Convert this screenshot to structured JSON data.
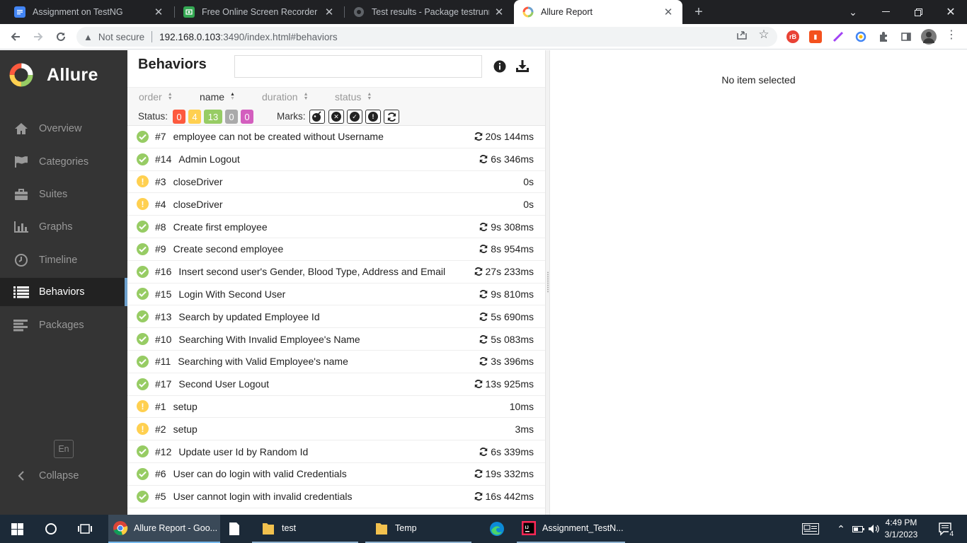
{
  "browser": {
    "tabs": [
      {
        "title": "Assignment on TestNG",
        "icon": "google-docs-icon",
        "active": false
      },
      {
        "title": "Free Online Screen Recorder | Onl",
        "icon": "screen-recorder-icon",
        "active": false
      },
      {
        "title": "Test results - Package testrunner",
        "icon": "globe-icon",
        "active": false
      },
      {
        "title": "Allure Report",
        "icon": "allure-icon",
        "active": true
      }
    ],
    "security_label": "Not secure",
    "url_host": "192.168.0.103",
    "url_path": ":3490/index.html#behaviors"
  },
  "sidebar": {
    "brand": "Allure",
    "items": [
      {
        "label": "Overview",
        "icon": "home-icon"
      },
      {
        "label": "Categories",
        "icon": "flag-icon"
      },
      {
        "label": "Suites",
        "icon": "briefcase-icon"
      },
      {
        "label": "Graphs",
        "icon": "bar-chart-icon"
      },
      {
        "label": "Timeline",
        "icon": "clock-icon"
      },
      {
        "label": "Behaviors",
        "icon": "list-icon",
        "active": true
      },
      {
        "label": "Packages",
        "icon": "align-left-icon"
      }
    ],
    "language": "En",
    "collapse_label": "Collapse"
  },
  "behaviors": {
    "title": "Behaviors",
    "sorters": [
      "order",
      "name",
      "duration",
      "status"
    ],
    "active_sorter": "name",
    "status_label": "Status:",
    "status_counts": [
      {
        "value": "0",
        "color": "#fd5a3e",
        "kind": "failed"
      },
      {
        "value": "4",
        "color": "#ffd050",
        "kind": "broken"
      },
      {
        "value": "13",
        "color": "#97cc64",
        "kind": "passed"
      },
      {
        "value": "0",
        "color": "#aaaaaa",
        "kind": "skipped"
      },
      {
        "value": "0",
        "color": "#d35ebe",
        "kind": "unknown"
      }
    ],
    "marks_label": "Marks:",
    "marks": [
      "flaky-icon",
      "new-failed-icon",
      "new-passed-icon",
      "new-broken-icon",
      "retries-icon"
    ],
    "rows": [
      {
        "num": "#7",
        "name": "employee can not be created without Username",
        "duration": "20s 144ms",
        "status": "passed",
        "retry": true
      },
      {
        "num": "#14",
        "name": "Admin Logout",
        "duration": "6s 346ms",
        "status": "passed",
        "retry": true
      },
      {
        "num": "#3",
        "name": "closeDriver",
        "duration": "0s",
        "status": "broken",
        "retry": false
      },
      {
        "num": "#4",
        "name": "closeDriver",
        "duration": "0s",
        "status": "broken",
        "retry": false
      },
      {
        "num": "#8",
        "name": "Create first employee",
        "duration": "9s 308ms",
        "status": "passed",
        "retry": true
      },
      {
        "num": "#9",
        "name": "Create second employee",
        "duration": "8s 954ms",
        "status": "passed",
        "retry": true
      },
      {
        "num": "#16",
        "name": "Insert second user's Gender, Blood Type, Address and Email",
        "duration": "27s 233ms",
        "status": "passed",
        "retry": true
      },
      {
        "num": "#15",
        "name": "Login With Second User",
        "duration": "9s 810ms",
        "status": "passed",
        "retry": true
      },
      {
        "num": "#13",
        "name": "Search by updated Employee Id",
        "duration": "5s 690ms",
        "status": "passed",
        "retry": true
      },
      {
        "num": "#10",
        "name": "Searching With Invalid Employee's Name",
        "duration": "5s 083ms",
        "status": "passed",
        "retry": true
      },
      {
        "num": "#11",
        "name": "Searching with Valid Employee's name",
        "duration": "3s 396ms",
        "status": "passed",
        "retry": true
      },
      {
        "num": "#17",
        "name": "Second User Logout",
        "duration": "13s 925ms",
        "status": "passed",
        "retry": true
      },
      {
        "num": "#1",
        "name": "setup",
        "duration": "10ms",
        "status": "broken",
        "retry": false
      },
      {
        "num": "#2",
        "name": "setup",
        "duration": "3ms",
        "status": "broken",
        "retry": false
      },
      {
        "num": "#12",
        "name": "Update user Id by Random Id",
        "duration": "6s 339ms",
        "status": "passed",
        "retry": true
      },
      {
        "num": "#6",
        "name": "User can do login with valid Credentials",
        "duration": "19s 332ms",
        "status": "passed",
        "retry": true
      },
      {
        "num": "#5",
        "name": "User cannot login with invalid credentials",
        "duration": "16s 442ms",
        "status": "passed",
        "retry": true
      }
    ]
  },
  "detail": {
    "empty_text": "No item selected"
  },
  "taskbar": {
    "items": [
      {
        "label": "Allure Report - Goo...",
        "icon": "chrome-icon"
      },
      {
        "label": "",
        "icon": "file-icon"
      },
      {
        "label": "test",
        "icon": "folder-icon"
      },
      {
        "label": "Temp",
        "icon": "folder-icon"
      },
      {
        "label": "",
        "icon": "edge-icon"
      },
      {
        "label": "Assignment_TestN...",
        "icon": "intellij-icon"
      }
    ],
    "time": "4:49 PM",
    "date": "3/1/2023",
    "notifications": "4"
  }
}
